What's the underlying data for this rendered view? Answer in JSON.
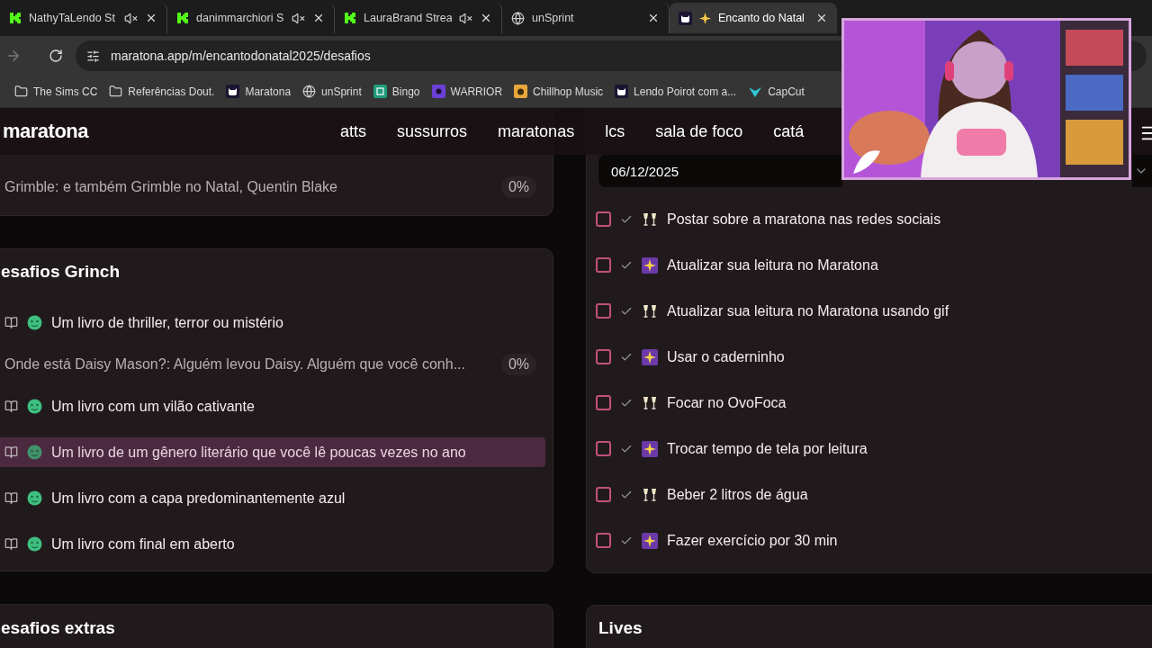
{
  "browser": {
    "tabs": [
      {
        "title": "NathyTaLendo St",
        "kind": "kick",
        "muted": true,
        "sparkle": false,
        "selected": false
      },
      {
        "title": "danimmarchiori S",
        "kind": "kick",
        "muted": true,
        "sparkle": false,
        "selected": false
      },
      {
        "title": "LauraBrand Strea",
        "kind": "kick",
        "muted": true,
        "sparkle": false,
        "selected": false
      },
      {
        "title": "unSprint",
        "kind": "globe",
        "muted": false,
        "sparkle": false,
        "selected": false
      },
      {
        "title": "Encanto do Natal",
        "kind": "cat",
        "muted": false,
        "sparkle": true,
        "selected": true
      }
    ],
    "address": "maratona.app/m/encantodonatal2025/desafios",
    "bookmarks": [
      {
        "label": "The Sims CC",
        "kind": "folder"
      },
      {
        "label": "Referências Dout.",
        "kind": "folder"
      },
      {
        "label": "Maratona",
        "kind": "cat"
      },
      {
        "label": "unSprint",
        "kind": "globe"
      },
      {
        "label": "Bingo",
        "kind": "bingo"
      },
      {
        "label": "WARRIOR",
        "kind": "warrior"
      },
      {
        "label": "Chillhop Music",
        "kind": "chillhop"
      },
      {
        "label": "Lendo Poirot com a...",
        "kind": "cat"
      },
      {
        "label": "CapCut",
        "kind": "capcut"
      }
    ]
  },
  "header": {
    "logo": "maratona",
    "nav": [
      "atts",
      "sussurros",
      "maratonas",
      "lcs",
      "sala de foco",
      "catá"
    ]
  },
  "left": {
    "top_card": {
      "book": {
        "title": "Grimble: e também Grimble no Natal, Quentin Blake",
        "progress": "0%"
      }
    },
    "grinch": {
      "title": "esafios Grinch",
      "items": [
        {
          "text": "Um livro de thriller, terror ou mistério",
          "highlighted": false,
          "book": {
            "title": "Onde está Daisy Mason?: Alguém levou Daisy. Alguém que você conh...",
            "progress": "0%"
          }
        },
        {
          "text": "Um livro com um vilão cativante",
          "highlighted": false
        },
        {
          "text": "Um livro de um gênero literário que você lê poucas vezes no ano",
          "highlighted": true
        },
        {
          "text": "Um livro com a capa predominantemente azul",
          "highlighted": false
        },
        {
          "text": "Um livro com final em aberto",
          "highlighted": false
        }
      ]
    },
    "extras": {
      "title": "esafios extras"
    }
  },
  "right": {
    "daily": {
      "date": "06/12/2025",
      "tasks": [
        {
          "text": "Postar sobre a maratona nas redes sociais",
          "kind": "toast",
          "checked": false
        },
        {
          "text": "Atualizar sua leitura no Maratona",
          "kind": "fireworks",
          "checked": false
        },
        {
          "text": "Atualizar sua leitura no Maratona usando gif",
          "kind": "toast",
          "checked": false
        },
        {
          "text": "Usar o caderninho",
          "kind": "fireworks",
          "checked": false
        },
        {
          "text": "Focar no OvoFoca",
          "kind": "toast",
          "checked": false
        },
        {
          "text": "Trocar tempo de tela por leitura",
          "kind": "fireworks",
          "checked": false
        },
        {
          "text": "Beber 2 litros de água",
          "kind": "toast",
          "checked": false
        },
        {
          "text": "Fazer exercício por 30 min",
          "kind": "fireworks",
          "checked": false
        }
      ]
    },
    "lives": {
      "title": "Lives"
    }
  }
}
